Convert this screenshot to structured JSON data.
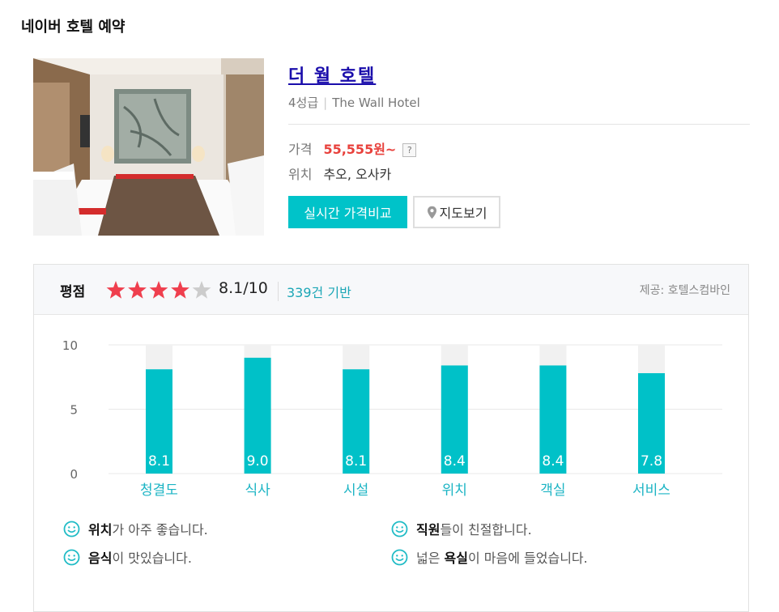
{
  "page_title": "네이버 호텔 예약",
  "hotel": {
    "name": "더 월 호텔",
    "grade": "4성급",
    "english_name": "The Wall Hotel",
    "price_label": "가격",
    "price": "55,555원~",
    "help_glyph": "?",
    "location_label": "위치",
    "location": "추오, 오사카"
  },
  "buttons": {
    "compare": "실시간 가격비교",
    "map": "지도보기"
  },
  "rating": {
    "label": "평점",
    "score": "8.1/10",
    "review_count": "339건 기반",
    "provider": "제공: 호텔스컴바인",
    "stars": 4,
    "star_color": "#ef3f4e",
    "star_empty_color": "#cccccc"
  },
  "chart_data": {
    "type": "bar",
    "categories": [
      "청결도",
      "식사",
      "시설",
      "위치",
      "객실",
      "서비스"
    ],
    "values": [
      8.1,
      9.0,
      8.1,
      8.4,
      8.4,
      7.8
    ],
    "value_labels": [
      "8.1",
      "9.0",
      "8.1",
      "8.4",
      "8.4",
      "7.8"
    ],
    "yticks": [
      "0",
      "5",
      "10"
    ],
    "ylim": [
      0,
      10
    ],
    "bar_color": "#00c1c8",
    "track_color": "#f1f1f1",
    "category_color": "#1bb4c4",
    "grid": true
  },
  "reviews": [
    {
      "pre": "",
      "bold": "위치",
      "post": "가 아주 좋습니다."
    },
    {
      "pre": "",
      "bold": "직원",
      "post": "들이 친절합니다."
    },
    {
      "pre": "",
      "bold": "음식",
      "post": "이 맛있습니다."
    },
    {
      "pre": "넓은 ",
      "bold": "욕실",
      "post": "이 마음에 들었습니다."
    }
  ],
  "icons": {
    "map_pin": "map-pin-icon",
    "smile": "smile-icon",
    "star": "star-icon"
  },
  "colors": {
    "accent": "#00c3c9",
    "price": "#e8413c",
    "link": "#1a0dab"
  }
}
